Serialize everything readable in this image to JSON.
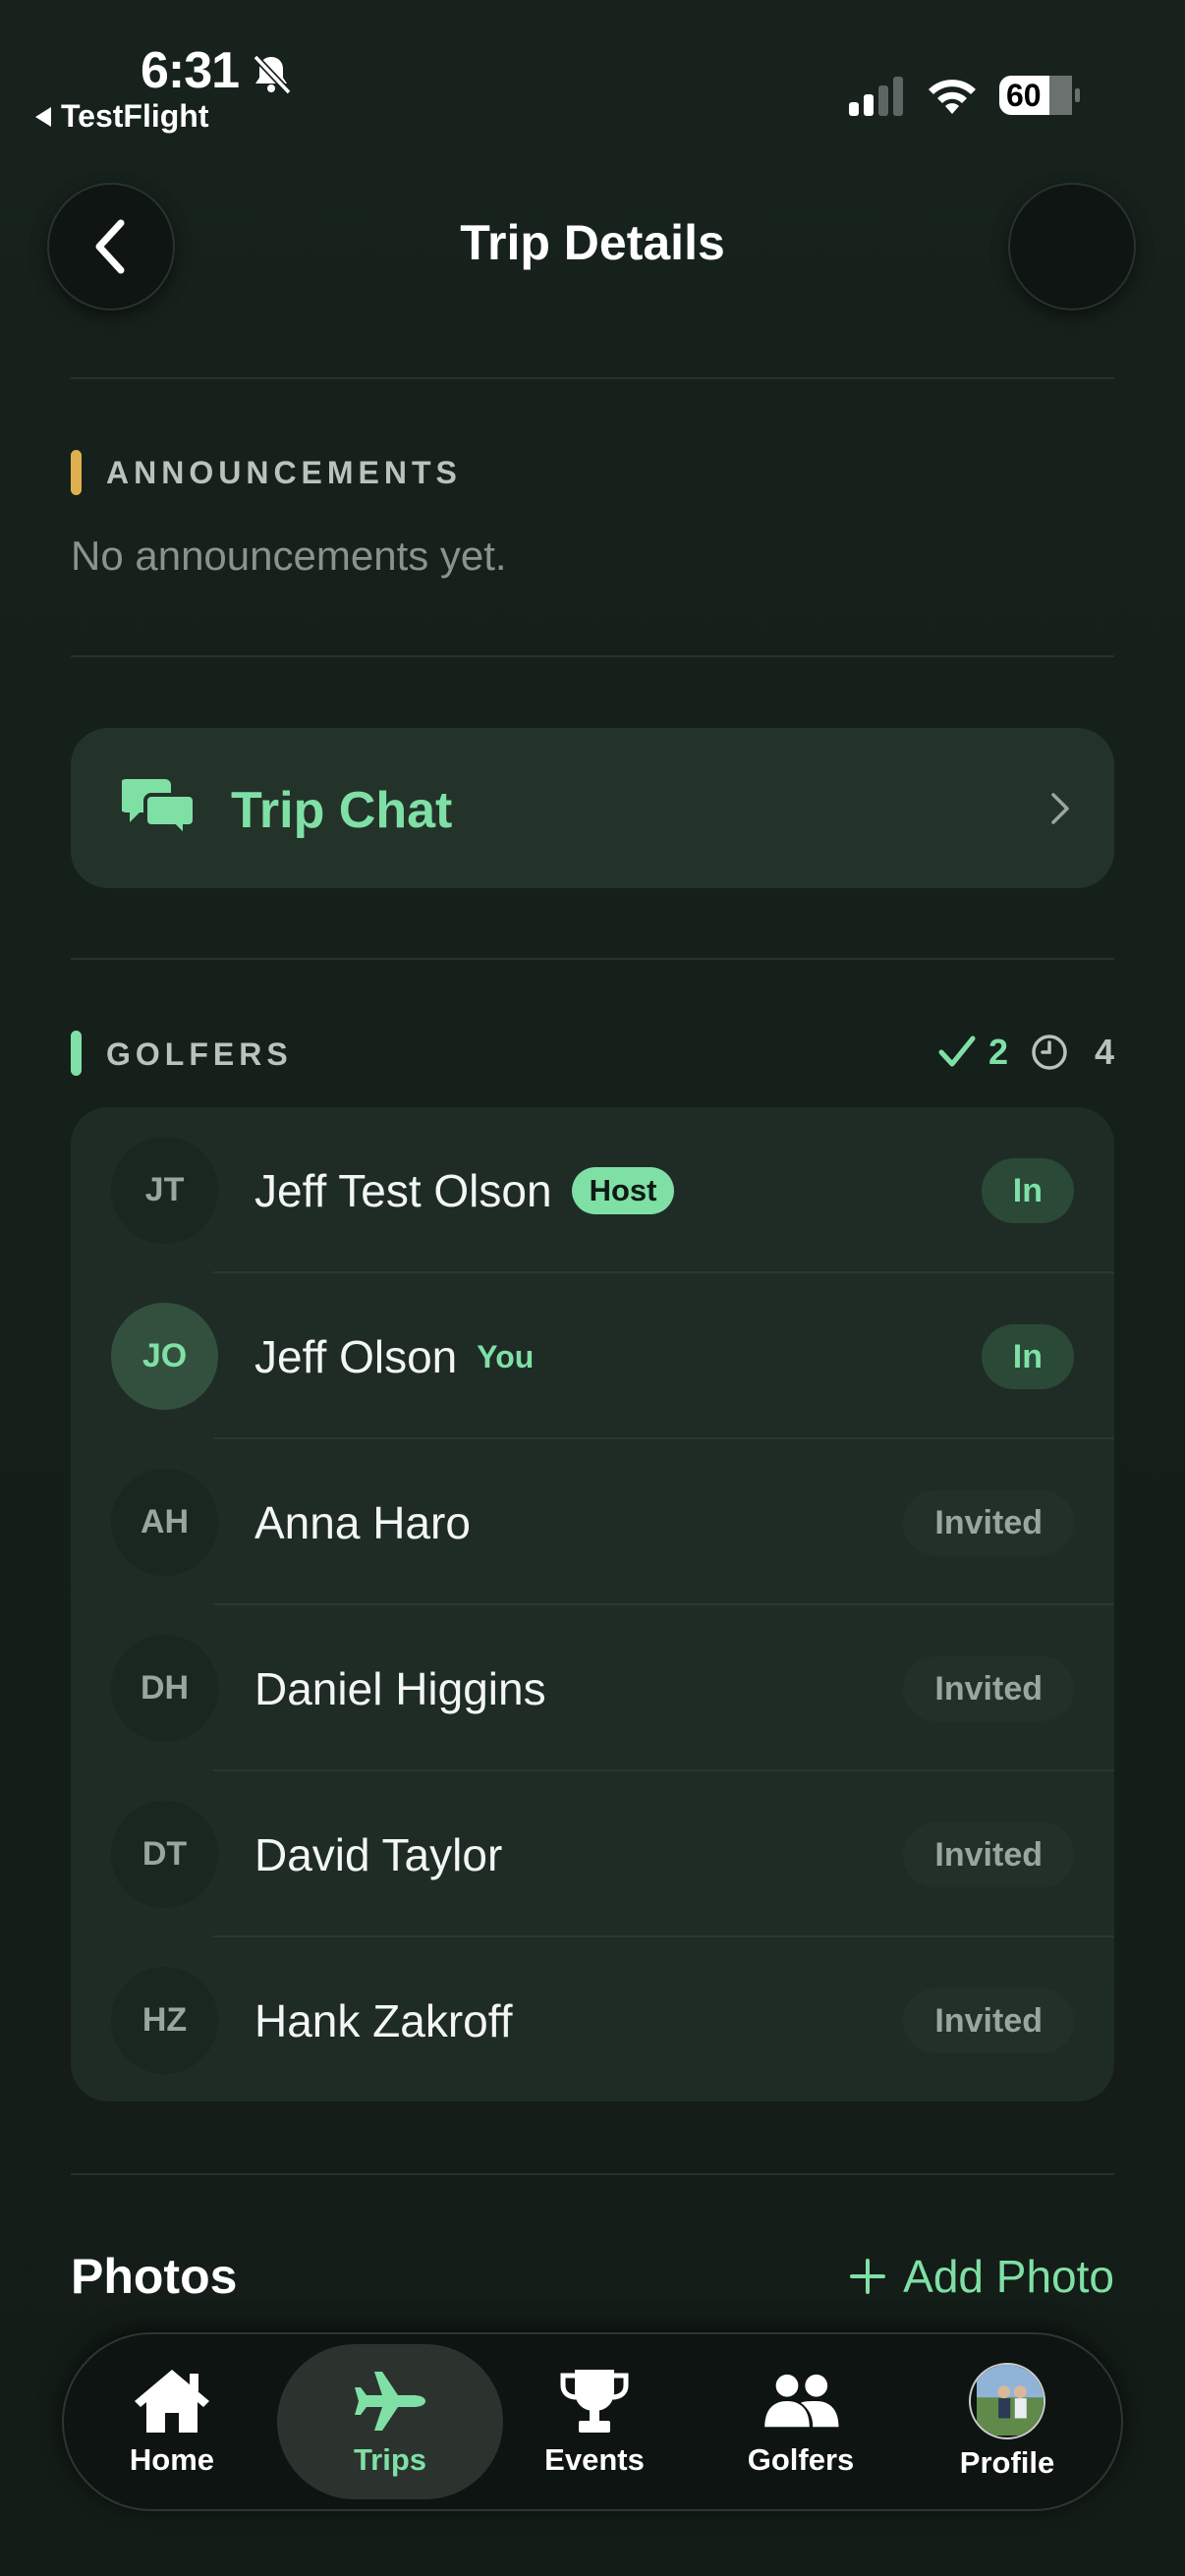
{
  "status_bar": {
    "time": "6:31",
    "back_app": "TestFlight",
    "battery": "60"
  },
  "header": {
    "title": "Trip Details"
  },
  "announcements": {
    "label": "ANNOUNCEMENTS",
    "empty_text": "No announcements yet.",
    "accent": "#e0b050"
  },
  "trip_chat": {
    "label": "Trip Chat"
  },
  "golfers": {
    "label": "GOLFERS",
    "accent": "#7fe0a6",
    "confirmed_count": "2",
    "pending_count": "4",
    "list": [
      {
        "initials": "JT",
        "name": "Jeff Test Olson",
        "badge": "Host",
        "tag": "",
        "status": "In",
        "status_type": "in"
      },
      {
        "initials": "JO",
        "name": "Jeff Olson",
        "badge": "",
        "tag": "You",
        "status": "In",
        "status_type": "in"
      },
      {
        "initials": "AH",
        "name": "Anna Haro",
        "badge": "",
        "tag": "",
        "status": "Invited",
        "status_type": "invited"
      },
      {
        "initials": "DH",
        "name": "Daniel Higgins",
        "badge": "",
        "tag": "",
        "status": "Invited",
        "status_type": "invited"
      },
      {
        "initials": "DT",
        "name": "David Taylor",
        "badge": "",
        "tag": "",
        "status": "Invited",
        "status_type": "invited"
      },
      {
        "initials": "HZ",
        "name": "Hank Zakroff",
        "badge": "",
        "tag": "",
        "status": "Invited",
        "status_type": "invited"
      }
    ]
  },
  "photos": {
    "title": "Photos",
    "add_label": "Add Photo"
  },
  "tabbar": {
    "items": [
      {
        "label": "Home",
        "icon": "house-icon",
        "active": false
      },
      {
        "label": "Trips",
        "icon": "airplane-icon",
        "active": true
      },
      {
        "label": "Events",
        "icon": "trophy-icon",
        "active": false
      },
      {
        "label": "Golfers",
        "icon": "people-icon",
        "active": false
      },
      {
        "label": "Profile",
        "icon": "profile-photo",
        "active": false
      }
    ]
  },
  "colors": {
    "accent_green": "#7fe0a6",
    "background": "#17221c",
    "card": "#1f2c25"
  }
}
